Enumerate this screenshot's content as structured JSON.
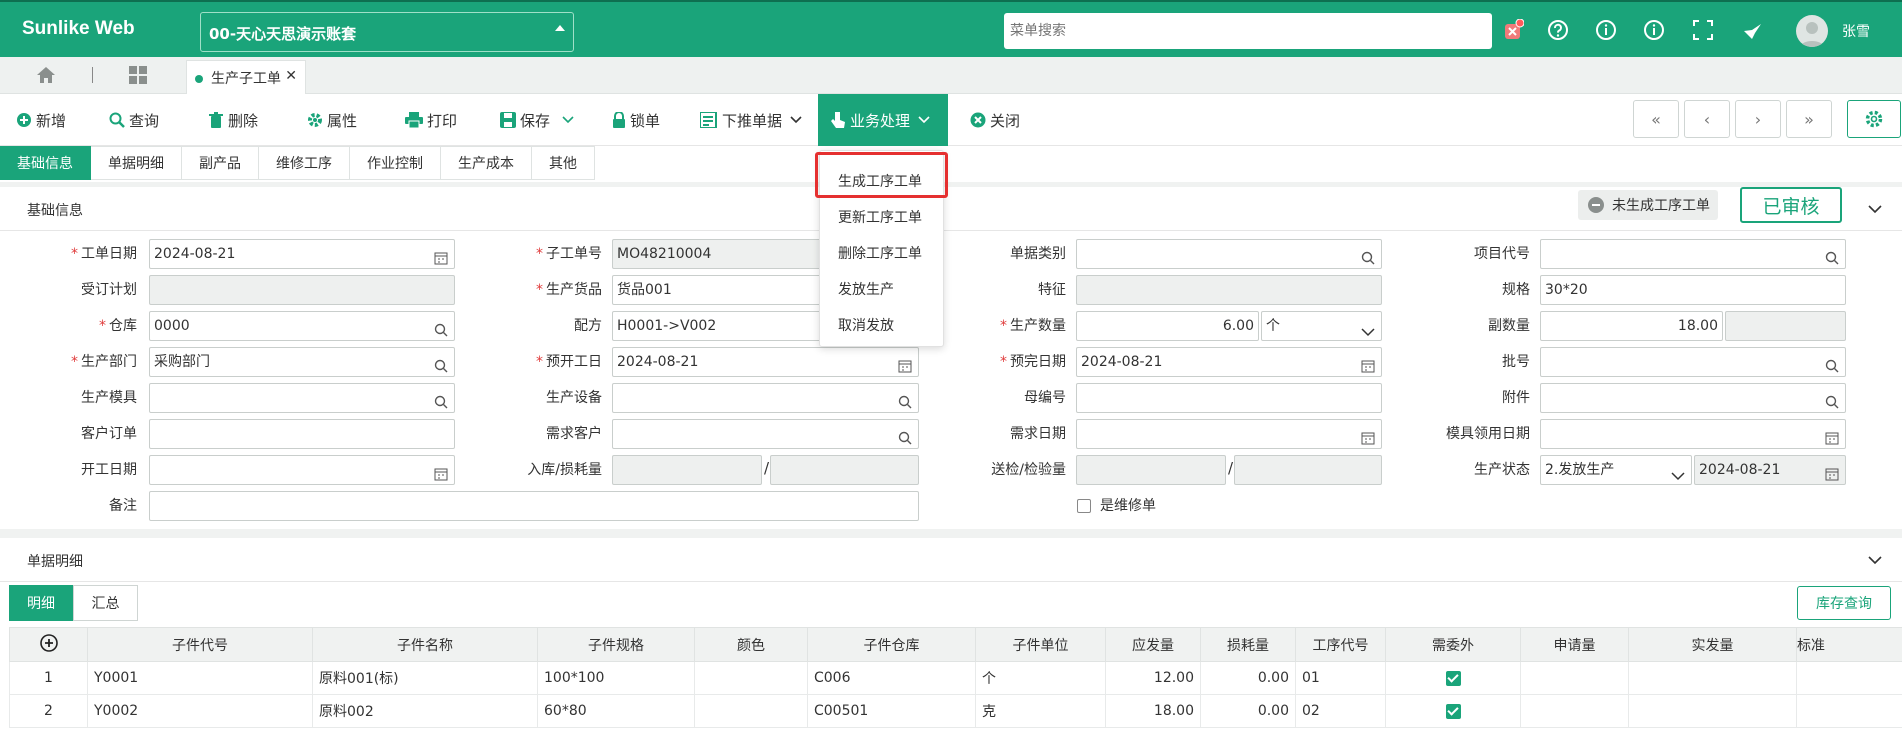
{
  "app": {
    "title": "Sunlike Web",
    "account": "00-天心天思演示账套",
    "search_placeholder": "菜单搜索",
    "user": "张雪"
  },
  "tabs": {
    "doc_tab": "生产子工单"
  },
  "toolbar": {
    "add": "新增",
    "query": "查询",
    "delete": "删除",
    "attr": "属性",
    "print": "打印",
    "save": "保存",
    "lock": "锁单",
    "push": "下推单据",
    "business": "业务处理",
    "close": "关闭"
  },
  "section_tabs": [
    "基础信息",
    "单据明细",
    "副产品",
    "维修工序",
    "作业控制",
    "生产成本",
    "其他"
  ],
  "basic": {
    "title": "基础信息",
    "status_badge": "未生成工序工单",
    "audited": "已审核"
  },
  "dropdown": [
    "生成工序工单",
    "更新工序工单",
    "删除工序工单",
    "发放生产",
    "取消发放"
  ],
  "form": {
    "labels": {
      "work_date": "工单日期",
      "order_plan": "受订计划",
      "warehouse": "仓库",
      "dept": "生产部门",
      "mold": "生产模具",
      "customer_order": "客户订单",
      "start_date": "开工日期",
      "remark": "备注",
      "sub_no": "子工单号",
      "product": "生产货品",
      "recipe": "配方",
      "plan_start": "预开工日",
      "equipment": "生产设备",
      "demand_customer": "需求客户",
      "in_loss": "入库/损耗量",
      "doc_type": "单据类别",
      "feature": "特征",
      "qty": "生产数量",
      "plan_end": "预完日期",
      "parent_no": "母编号",
      "demand_date": "需求日期",
      "inspect_qty": "送检/检验量",
      "is_repair": "是维修单",
      "project_code": "项目代号",
      "spec": "规格",
      "sub_qty": "副数量",
      "batch": "批号",
      "attachment": "附件",
      "mold_date": "模具领用日期",
      "prod_status": "生产状态"
    },
    "values": {
      "work_date": "2024-08-21",
      "warehouse": "0000",
      "dept": "采购部门",
      "sub_no": "MO48210004",
      "product": "货品001",
      "recipe": "H0001->V002",
      "plan_start": "2024-08-21",
      "qty": "6.00",
      "qty_unit": "个",
      "plan_end": "2024-08-21",
      "spec": "30*20",
      "sub_qty": "18.00",
      "prod_status": "2.发放生产",
      "status_date": "2024-08-21"
    }
  },
  "detail": {
    "title": "单据明细",
    "subtabs": [
      "明细",
      "汇总"
    ],
    "stock_btn": "库存查询",
    "columns": [
      "子件代号",
      "子件名称",
      "子件规格",
      "颜色",
      "子件仓库",
      "子件单位",
      "应发量",
      "损耗量",
      "工序代号",
      "需委外",
      "申请量",
      "实发量",
      "标准"
    ],
    "rows": [
      {
        "no": "1",
        "code": "Y0001",
        "name": "原料001(标)",
        "spec": "100*100",
        "color": "",
        "wh": "C006",
        "unit": "个",
        "qty": "12.00",
        "loss": "0.00",
        "proc": "01"
      },
      {
        "no": "2",
        "code": "Y0002",
        "name": "原料002",
        "spec": "60*80",
        "color": "",
        "wh": "C00501",
        "unit": "克",
        "qty": "18.00",
        "loss": "0.00",
        "proc": "02"
      }
    ]
  }
}
